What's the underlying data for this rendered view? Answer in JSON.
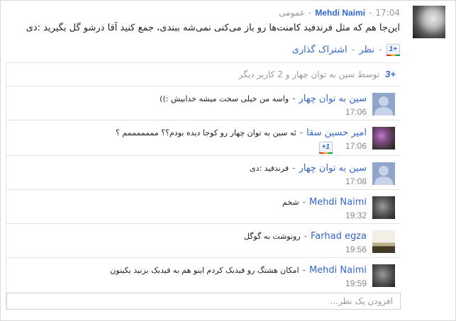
{
  "post": {
    "author": "Mehdi Naimi",
    "time": "17:04",
    "visibility": "عمومی",
    "separator": "-",
    "text": "این‌جا هم که مثل فرندفید کامنت‌ها رو باز می‌کنی نمی‌شه ببندی، جمع کنید آقا درشو گل بگیرید :دی",
    "plus_one_label": "+1",
    "comment_label": "نظر",
    "share_label": "اشتراک گذاری",
    "actions_sep": "-"
  },
  "summary": {
    "plus_icon": "+3",
    "text": "توسط سین به توان چهار و 2 کاربر دیگر"
  },
  "comments": [
    {
      "name": "سین به توان چهار",
      "text": "واسه من خیلی سخت میشه خدابیش :))",
      "time": "17:06",
      "avatar": "default-silhouette"
    },
    {
      "name": "امیر حسین سقا",
      "text": "ئه سین به توان چهار رو کوجا دیده بودم؟؟ مممممممم ؟",
      "time": "17:06",
      "avatar": "photo",
      "plus_one": "+1"
    },
    {
      "name": "سین به توان چهار",
      "text": "فرندفید :دی",
      "time": "17:08",
      "avatar": "default-silhouette"
    },
    {
      "name": "Mehdi Naimi",
      "text": "شخم",
      "time": "19:32",
      "avatar": "photo"
    },
    {
      "name": "Farhad egza",
      "text": "رونوشت به گوگل",
      "time": "19:56",
      "avatar": "photo"
    },
    {
      "name": "Mehdi Naimi",
      "text": "امکان هشتگ رو فیدبک کردم اینو هم به فیدبک بزنید یکینون",
      "time": "19:59",
      "avatar": "photo"
    }
  ],
  "comment_dash": "-",
  "add_comment": {
    "placeholder": "افزودن یک نظر..."
  },
  "colors": {
    "link": "#3366cc",
    "muted": "#999999",
    "divider": "#e2e2e2"
  }
}
